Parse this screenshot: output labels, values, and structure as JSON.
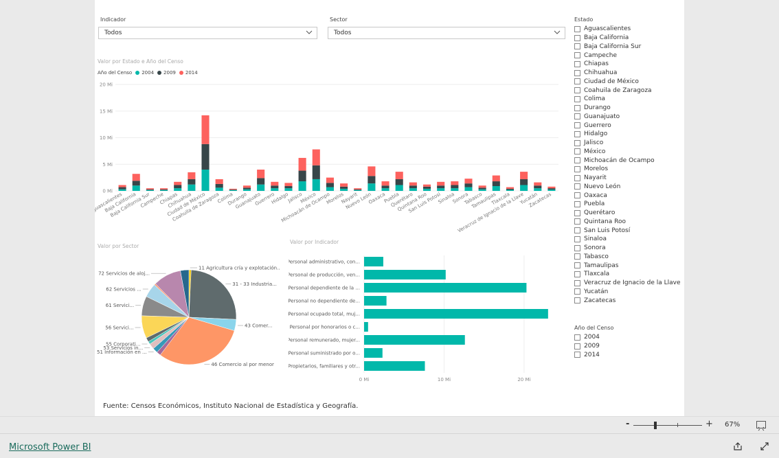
{
  "slicers": {
    "indicador": {
      "title": "Indicador",
      "value": "Todos"
    },
    "sector": {
      "title": "Sector",
      "value": "Todos"
    }
  },
  "bar_chart": {
    "title": "Valor por Estado e Año del Censo",
    "legend_title": "Año del Censo",
    "legend": [
      "2004",
      "2009",
      "2014"
    ]
  },
  "pie_chart": {
    "title": "Valor por Sector"
  },
  "hbar_chart": {
    "title": "Valor por Indicador"
  },
  "colors": {
    "s2004": "#01b8aa",
    "s2009": "#374649",
    "s2014": "#fd625e",
    "teal": "#01b8aa"
  },
  "chart_data": [
    {
      "type": "bar",
      "stacked": true,
      "title": "Valor por Estado e Año del Censo",
      "legend_title": "Año del Censo",
      "categories": [
        "Aguascalientes",
        "Baja California",
        "Baja California Sur",
        "Campeche",
        "Chiapas",
        "Chihuahua",
        "Ciudad de México",
        "Coahuila de Zaragoza",
        "Colima",
        "Durango",
        "Guanajuato",
        "Guerrero",
        "Hidalgo",
        "Jalisco",
        "México",
        "Michoacán de Ocampo",
        "Morelos",
        "Nayarit",
        "Nuevo León",
        "Oaxaca",
        "Puebla",
        "Querétaro",
        "Quintana Roo",
        "San Luis Potosí",
        "Sinaloa",
        "Sonora",
        "Tabasco",
        "Tamaulipas",
        "Tlaxcala",
        "Veracruz de Ignacio de la Llave",
        "Yucatán",
        "Zacatecas"
      ],
      "series": [
        {
          "name": "2004",
          "values": [
            0.3,
            1.0,
            0.15,
            0.15,
            0.5,
            1.2,
            4.0,
            0.6,
            0.15,
            0.3,
            1.2,
            0.5,
            0.5,
            1.8,
            2.2,
            0.7,
            0.4,
            0.15,
            1.4,
            0.5,
            1.1,
            0.5,
            0.4,
            0.5,
            0.5,
            0.7,
            0.3,
            0.9,
            0.2,
            1.1,
            0.5,
            0.25
          ]
        },
        {
          "name": "2009",
          "values": [
            0.4,
            0.9,
            0.15,
            0.15,
            0.6,
            1.0,
            4.8,
            0.7,
            0.1,
            0.3,
            1.2,
            0.5,
            0.4,
            2.0,
            2.6,
            0.8,
            0.4,
            0.15,
            1.4,
            0.5,
            1.1,
            0.5,
            0.4,
            0.5,
            0.6,
            0.7,
            0.3,
            0.9,
            0.2,
            1.1,
            0.5,
            0.25
          ]
        },
        {
          "name": "2014",
          "values": [
            0.4,
            1.3,
            0.2,
            0.2,
            0.6,
            1.3,
            5.4,
            0.9,
            0.15,
            0.4,
            1.6,
            0.7,
            0.6,
            2.4,
            3.0,
            1.0,
            0.6,
            0.2,
            1.8,
            0.8,
            1.4,
            0.6,
            0.4,
            0.7,
            0.7,
            0.9,
            0.4,
            1.1,
            0.3,
            1.4,
            0.6,
            0.3
          ]
        }
      ],
      "ylim": [
        0,
        20
      ],
      "yticks": [
        "0 Mi",
        "5 Mi",
        "10 Mi",
        "15 Mi",
        "20 Mi"
      ],
      "ytick_values": [
        0,
        5,
        10,
        15,
        20
      ]
    },
    {
      "type": "pie",
      "title": "Valor por Sector",
      "labels": [
        "11 Agricultura cría y explotación...",
        "31 - 33 Industria...",
        "43 Comer...",
        "46 Comercio al por menor",
        "",
        "51 Información en ...",
        "53 Servicios in...",
        "55 Corporati...",
        "",
        "56 Servici...",
        "61 Servici...",
        "62 Servicios ...",
        "",
        "72 Servicios de aloj...",
        ""
      ],
      "values": [
        0.8,
        26,
        4,
        32,
        1.5,
        1.8,
        2,
        1,
        1.5,
        8,
        7,
        5,
        0.5,
        10,
        3
      ],
      "colors": [
        "#f2c80f",
        "#5f6b6d",
        "#8ad4eb",
        "#fe9666",
        "#a66999",
        "#3599b8",
        "#dfbfbf",
        "#4ac5bb",
        "#5f6b6d",
        "#fbd657",
        "#8a8a8a",
        "#a7d5ea",
        "#fd9b73",
        "#b887ad",
        "#26688d"
      ]
    },
    {
      "type": "bar",
      "orientation": "horizontal",
      "title": "Valor por Indicador",
      "categories": [
        "Personal administrativo, con...",
        "Personal de producción, ven...",
        "Personal dependiente de la ...",
        "Personal no dependiente de...",
        "Personal ocupado total, muj...",
        "Personal por honorarios o c...",
        "Personal remunerado, mujer...",
        "Personal suministrado por o...",
        "Propietarios, familiares y otr..."
      ],
      "values": [
        2.4,
        10.2,
        20.3,
        2.8,
        23.0,
        0.5,
        12.6,
        2.3,
        7.6
      ],
      "xlim": [
        0,
        23.7
      ],
      "xticks": [
        "0 Mi",
        "10 Mi",
        "20 Mi"
      ],
      "xtick_values": [
        0,
        10,
        20
      ]
    }
  ],
  "estado_slicer": {
    "title": "Estado",
    "items": [
      "Aguascalientes",
      "Baja California",
      "Baja California Sur",
      "Campeche",
      "Chiapas",
      "Chihuahua",
      "Ciudad de México",
      "Coahuila de Zaragoza",
      "Colima",
      "Durango",
      "Guanajuato",
      "Guerrero",
      "Hidalgo",
      "Jalisco",
      "México",
      "Michoacán de Ocampo",
      "Morelos",
      "Nayarit",
      "Nuevo León",
      "Oaxaca",
      "Puebla",
      "Querétaro",
      "Quintana Roo",
      "San Luis Potosí",
      "Sinaloa",
      "Sonora",
      "Tabasco",
      "Tamaulipas",
      "Tlaxcala",
      "Veracruz de Ignacio de la Llave",
      "Yucatán",
      "Zacatecas"
    ]
  },
  "anio_slicer": {
    "title": "Año del Censo",
    "items": [
      "2004",
      "2009",
      "2014"
    ]
  },
  "source_text": "Fuente: Censos Económicos, Instituto Nacional de Estadística y Geografía.",
  "zoom": {
    "minus": "-",
    "plus": "+",
    "percent": "67%",
    "level": 0.67
  },
  "footer": {
    "brand": "Microsoft Power BI"
  }
}
